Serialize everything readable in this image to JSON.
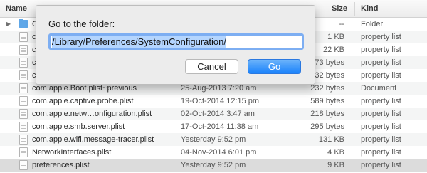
{
  "columns": {
    "name": "Name",
    "size": "Size",
    "kind": "Kind"
  },
  "rows": [
    {
      "name": "C",
      "date": "",
      "size": "--",
      "kind": "Folder",
      "type": "folder"
    },
    {
      "name": "c",
      "date": "",
      "size": "1 KB",
      "kind": "property list",
      "type": "file"
    },
    {
      "name": "c",
      "date": "",
      "size": "22 KB",
      "kind": "property list",
      "type": "file"
    },
    {
      "name": "c",
      "date": "",
      "size": "73 bytes",
      "kind": "property list",
      "type": "file"
    },
    {
      "name": "c",
      "date": "",
      "size": "32 bytes",
      "kind": "property list",
      "type": "file"
    },
    {
      "name": "com.apple.Boot.plist~previous",
      "date": "25-Aug-2013 7:20 am",
      "size": "232 bytes",
      "kind": "Document",
      "type": "file"
    },
    {
      "name": "com.apple.captive.probe.plist",
      "date": "19-Oct-2014 12:15 pm",
      "size": "589 bytes",
      "kind": "property list",
      "type": "file"
    },
    {
      "name": "com.apple.netw…onfiguration.plist",
      "date": "02-Oct-2014 3:47 am",
      "size": "218 bytes",
      "kind": "property list",
      "type": "file"
    },
    {
      "name": "com.apple.smb.server.plist",
      "date": "17-Oct-2014 11:38 am",
      "size": "295 bytes",
      "kind": "property list",
      "type": "file"
    },
    {
      "name": "com.apple.wifi.message-tracer.plist",
      "date": "Yesterday 9:52 pm",
      "size": "131 KB",
      "kind": "property list",
      "type": "file"
    },
    {
      "name": "NetworkInterfaces.plist",
      "date": "04-Nov-2014 6:01 pm",
      "size": "4 KB",
      "kind": "property list",
      "type": "file"
    },
    {
      "name": "preferences.plist",
      "date": "Yesterday 9:52 pm",
      "size": "9 KB",
      "kind": "property list",
      "type": "file"
    }
  ],
  "dialog": {
    "title": "Go to the folder:",
    "path_value": "/Library/Preferences/SystemConfiguration/",
    "cancel_label": "Cancel",
    "go_label": "Go"
  },
  "colors": {
    "accent": "#1a82fb",
    "selection": "#b4d5fe",
    "focus_ring": "#7daef2"
  }
}
